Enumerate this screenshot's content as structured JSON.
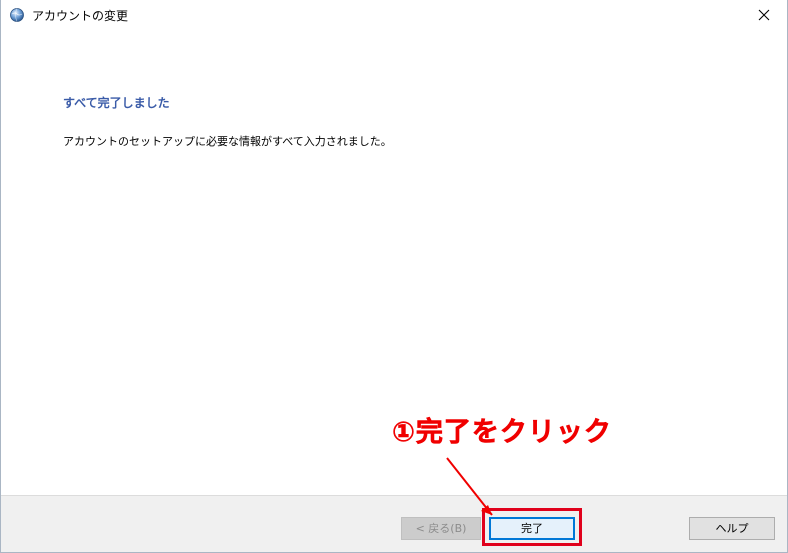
{
  "window": {
    "title": "アカウントの変更",
    "close_glyph": "✕"
  },
  "content": {
    "heading": "すべて完了しました",
    "message": "アカウントのセットアップに必要な情報がすべて入力されました。"
  },
  "footer": {
    "back_label": "< 戻る(B)",
    "finish_label": "完了",
    "help_label": "ヘルプ"
  },
  "annotation": {
    "callout_text": "①完了をクリック",
    "color": "#f00000"
  },
  "colors": {
    "heading": "#3a5ba8",
    "accent": "#0078d7",
    "footer_bg": "#f0f0f0"
  }
}
